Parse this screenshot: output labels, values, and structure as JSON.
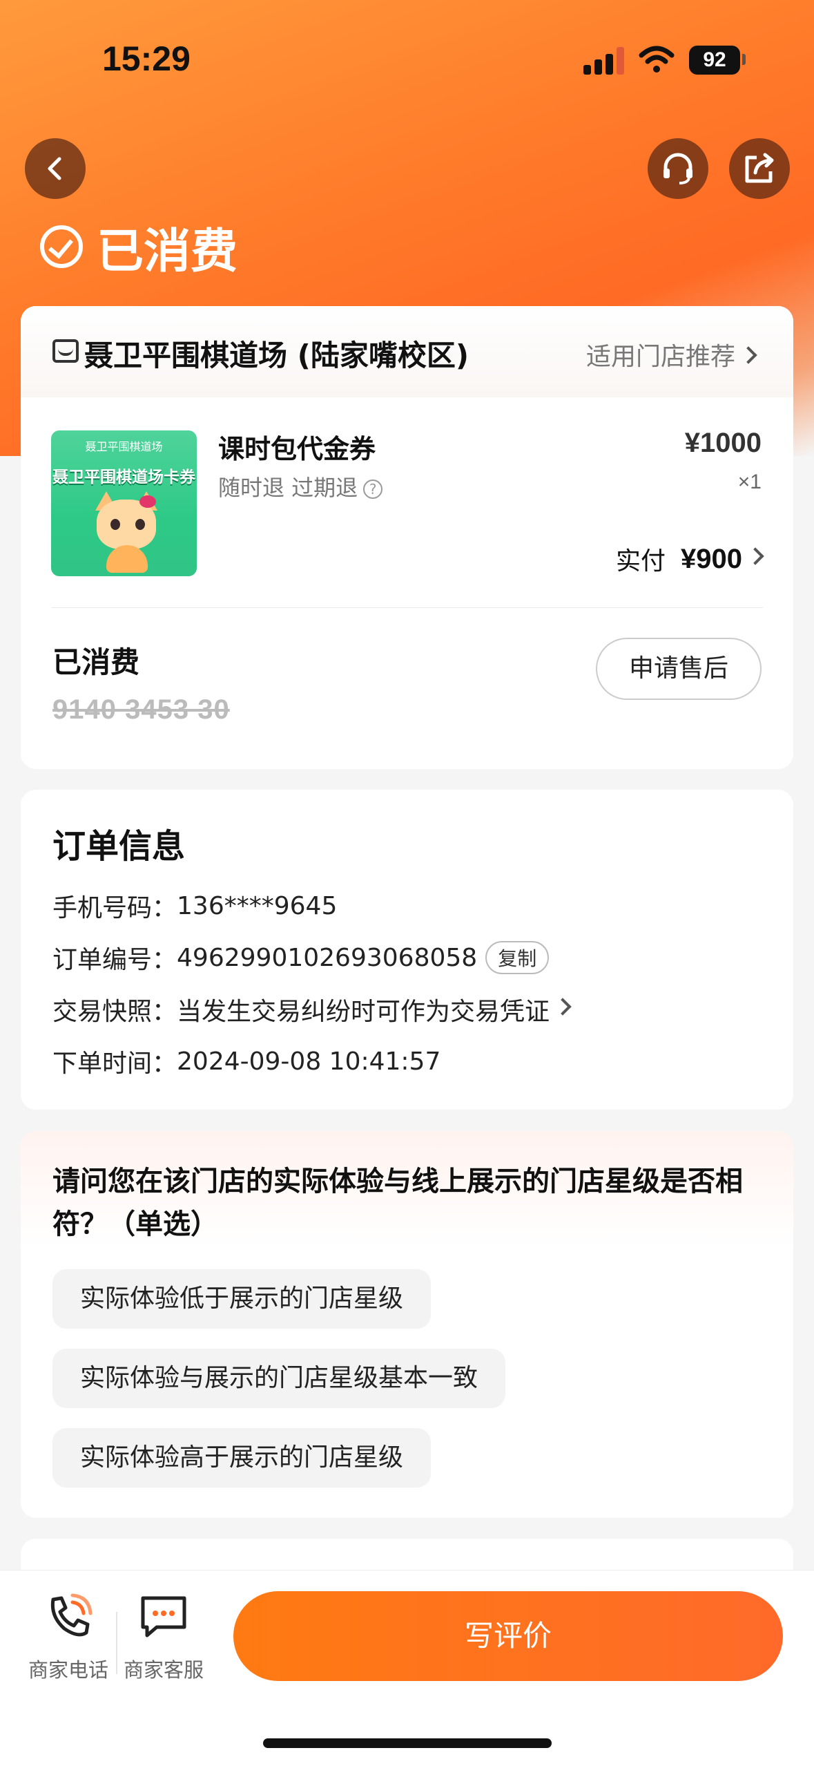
{
  "status_bar": {
    "time": "15:29",
    "battery": "92"
  },
  "header": {
    "status_title": "已消费"
  },
  "order_card": {
    "store_name": "聂卫平围棋道场 (陆家嘴校区)",
    "store_recommend": "适用门店推荐",
    "coupon_image": {
      "brand": "聂卫平围棋道场",
      "title": "聂卫平围棋道场卡券"
    },
    "item_title": "课时包代金券",
    "item_subtitle": "随时退 过期退",
    "price": "¥1000",
    "quantity": "×1",
    "paid_label": "实付",
    "paid_amount": "¥900",
    "consumed_label": "已消费",
    "voucher_code": "9140 3453 30",
    "after_sale_button": "申请售后"
  },
  "order_info": {
    "title": "订单信息",
    "rows": [
      {
        "label": "手机号码：",
        "value": "136****9645"
      },
      {
        "label": "订单编号：",
        "value": "4962990102693068058"
      },
      {
        "label": "交易快照：",
        "value": "当发生交易纠纷时可作为交易凭证"
      },
      {
        "label": "下单时间：",
        "value": "2024-09-08 10:41:57"
      }
    ],
    "copy_button": "复制"
  },
  "survey": {
    "question": "请问您在该门店的实际体验与线上展示的门店星级是否相符？（单选）",
    "options": [
      "实际体验低于展示的门店星级",
      "实际体验与展示的门店星级基本一致",
      "实际体验高于展示的门店星级"
    ]
  },
  "bottom_bar": {
    "merchant_phone": "商家电话",
    "merchant_service": "商家客服",
    "write_review": "写评价"
  },
  "colors": {
    "accent": "#ff6a24",
    "review_button": "#ff7a12"
  }
}
